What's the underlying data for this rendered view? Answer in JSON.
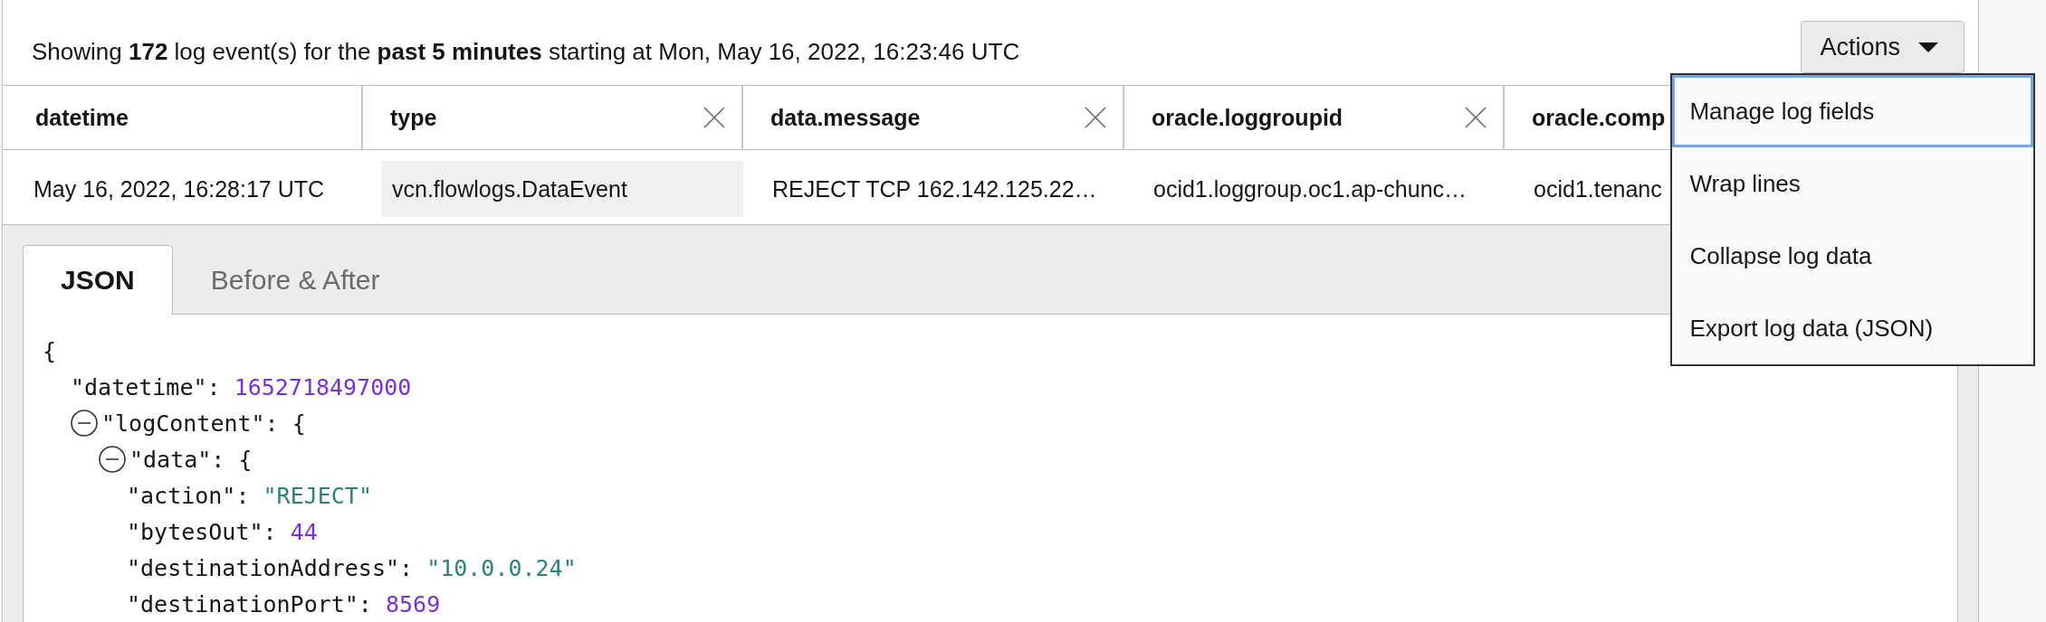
{
  "summary": "Showing **172** log event(s) for the **past 5 minutes** starting at Mon, May 16, 2022, 16:23:46 UTC",
  "actions": {
    "label": "Actions",
    "expanded": true,
    "menu": [
      {
        "label": "Manage log fields",
        "selected": true
      },
      {
        "label": "Wrap lines",
        "selected": false
      },
      {
        "label": "Collapse log data",
        "selected": false
      },
      {
        "label": "Export log data (JSON)",
        "selected": false
      }
    ]
  },
  "table": {
    "columns": [
      {
        "label": "datetime",
        "removable": false
      },
      {
        "label": "type",
        "removable": true
      },
      {
        "label": "data.message",
        "removable": true
      },
      {
        "label": "oracle.loggroupid",
        "removable": true
      },
      {
        "label": "oracle.comp",
        "removable": false
      }
    ],
    "rows": [
      {
        "cells": [
          {
            "text": "May 16, 2022, 16:28:17 UTC",
            "highlighted": false
          },
          {
            "text": "vcn.flowlogs.DataEvent",
            "highlighted": true
          },
          {
            "text": "REJECT TCP 162.142.125.22…",
            "highlighted": false
          },
          {
            "text": "ocid1.loggroup.oc1.ap-chunc…",
            "highlighted": false
          },
          {
            "text": "ocid1.tenanc",
            "highlighted": false
          }
        ]
      }
    ]
  },
  "details": {
    "tabs": [
      {
        "label": "JSON",
        "selected": true
      },
      {
        "label": "Before & After",
        "selected": false
      }
    ],
    "json": {
      "value": "{",
      "kind": "object",
      "children": [
        {
          "key": "\"datetime\":",
          "value": "1652718497000",
          "kind": "number"
        },
        {
          "key": "\"logContent\":",
          "value": "{",
          "kind": "object",
          "expanded": true,
          "children": [
            {
              "key": "\"data\":",
              "value": "{",
              "kind": "object",
              "expanded": true,
              "children": [
                {
                  "key": "\"action\":",
                  "value": "\"REJECT\"",
                  "kind": "string"
                },
                {
                  "key": "\"bytesOut\":",
                  "value": "44",
                  "kind": "number"
                },
                {
                  "key": "\"destinationAddress\":",
                  "value": "\"10.0.0.24\"",
                  "kind": "string"
                },
                {
                  "key": "\"destinationPort\":",
                  "value": "8569",
                  "kind": "number"
                }
              ]
            }
          ]
        }
      ]
    }
  }
}
